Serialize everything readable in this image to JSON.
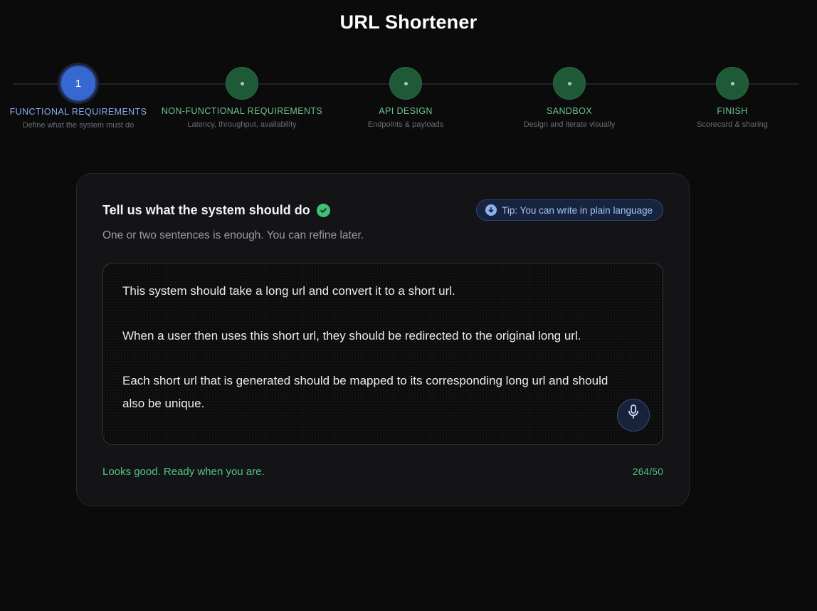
{
  "app": {
    "title": "URL Shortener"
  },
  "stepper": {
    "steps": [
      {
        "number": "1",
        "label": "FUNCTIONAL REQUIREMENTS",
        "sub": "Define what the system must do"
      },
      {
        "label": "NON-FUNCTIONAL REQUIREMENTS",
        "sub": "Latency, throughput, availability"
      },
      {
        "label": "API DESIGN",
        "sub": "Endpoints & payloads"
      },
      {
        "label": "SANDBOX",
        "sub": "Design and iterate visually"
      },
      {
        "label": "FINISH",
        "sub": "Scorecard & sharing"
      }
    ]
  },
  "card": {
    "title": "Tell us what the system should do",
    "subtitle": "One or two sentences is enough. You can refine later.",
    "tip": "Tip: You can write in plain language",
    "textarea": {
      "paragraphs": [
        "This system should take a long url and convert it to a short url.",
        "When a user then uses this short url, they should be redirected to the original long url.",
        "Each short url that is generated should be mapped to its corresponding long url and should also be unique."
      ]
    },
    "status": "Looks good. Ready when you are.",
    "counter": "264/50"
  },
  "colors": {
    "accent": "#3568d0",
    "success": "#4fc683",
    "completed_step": "#1f5a37",
    "background": "#0b0b0c"
  },
  "icons": {
    "check": "check-circle-icon",
    "tip": "arrow-down-circle-icon",
    "mic": "microphone-icon"
  }
}
